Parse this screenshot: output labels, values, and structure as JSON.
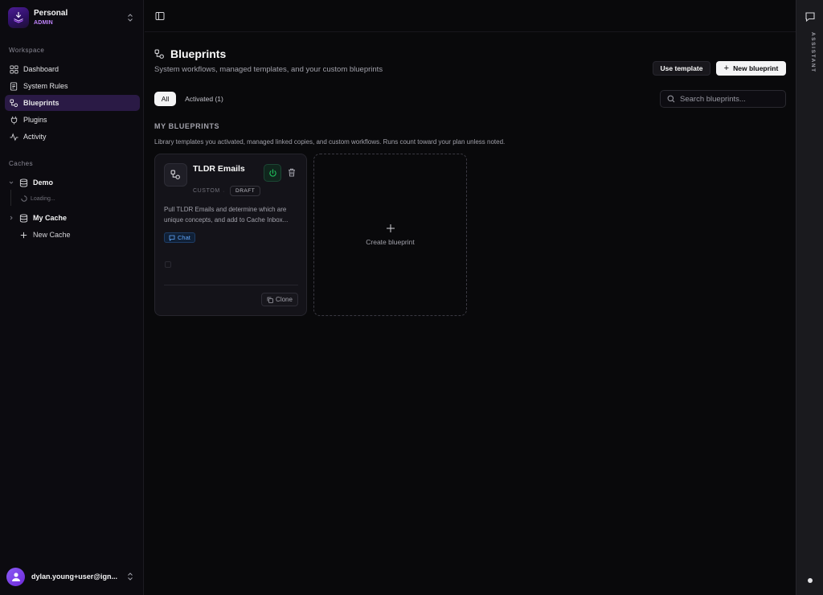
{
  "org": {
    "name": "Personal",
    "role": "ADMIN"
  },
  "sidebar": {
    "workspace_label": "Workspace",
    "items": [
      {
        "label": "Dashboard",
        "icon": "dashboard-icon"
      },
      {
        "label": "System Rules",
        "icon": "rules-icon"
      },
      {
        "label": "Blueprints",
        "icon": "blueprint-icon",
        "active": true
      },
      {
        "label": "Plugins",
        "icon": "plug-icon"
      },
      {
        "label": "Activity",
        "icon": "activity-icon"
      }
    ],
    "caches_label": "Caches",
    "caches": [
      {
        "label": "Demo",
        "expanded": true,
        "status": "Loading..."
      },
      {
        "label": "My Cache",
        "expanded": false
      }
    ],
    "new_cache_label": "New Cache"
  },
  "user": {
    "email": "dylan.young+user@ign..."
  },
  "page": {
    "title": "Blueprints",
    "subtitle": "System workflows, managed templates, and your custom blueprints",
    "use_template_label": "Use template",
    "new_blueprint_label": "New blueprint",
    "tabs": [
      {
        "label": "All",
        "active": true
      },
      {
        "label": "Activated (1)",
        "active": false
      }
    ],
    "search_placeholder": "Search blueprints...",
    "section_title": "MY BLUEPRINTS",
    "section_desc": "Library templates you activated, managed linked copies, and custom workflows. Runs count toward your plan unless noted."
  },
  "blueprints": [
    {
      "title": "TLDR Emails",
      "type": "CUSTOM",
      "separator": "·",
      "status": "DRAFT",
      "description": "Pull TLDR Emails and determine which are unique concepts, and add to Cache Inbox...",
      "tag": "Chat",
      "clone_label": "Clone"
    }
  ],
  "create_card_label": "Create blueprint",
  "assistant": {
    "label": "ASSISTANT"
  },
  "colors": {
    "accent": "#a855f7",
    "active_nav_bg": "#2a1a45",
    "power_green": "#22c55e",
    "tag_blue": "#60a5fa"
  }
}
